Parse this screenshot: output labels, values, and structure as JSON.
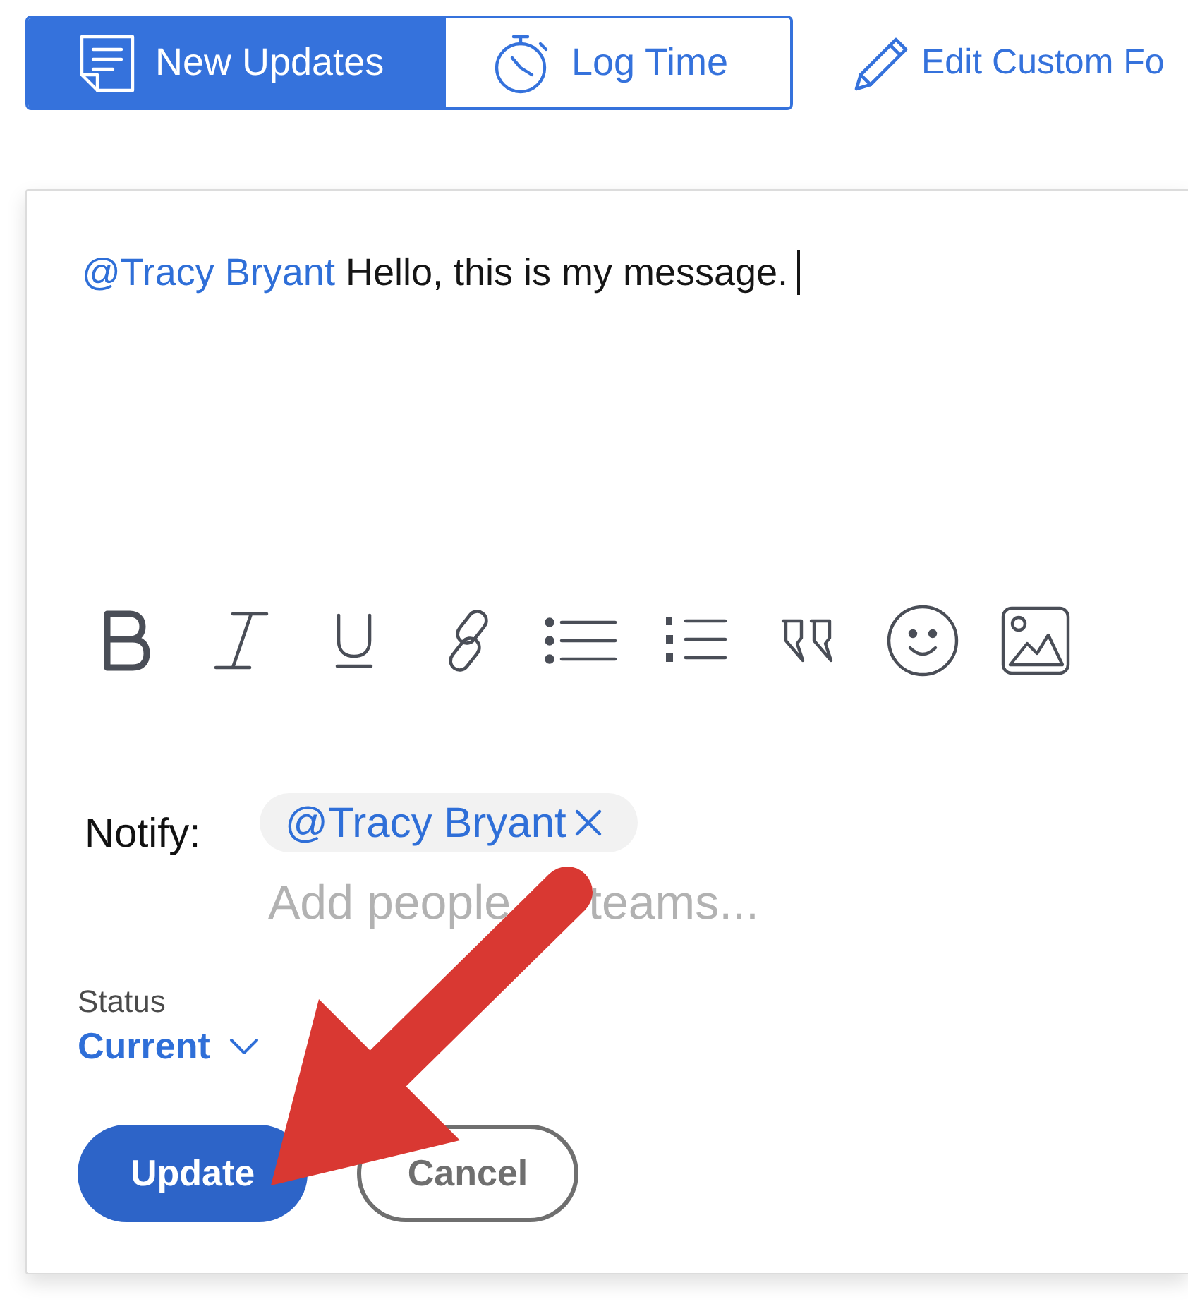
{
  "tabs": [
    {
      "label": "New Updates",
      "selected": true
    },
    {
      "label": "Log Time",
      "selected": false
    }
  ],
  "edit_link": {
    "label": "Edit Custom Fo"
  },
  "editor": {
    "mention": "@Tracy Bryant",
    "text": "Hello, this is my message.",
    "cursor": true
  },
  "notify": {
    "label": "Notify:",
    "chips": [
      {
        "label": "@Tracy Bryant"
      }
    ],
    "placeholder": [
      "Add people",
      "teams..."
    ]
  },
  "status": {
    "label": "Status",
    "value": "Current"
  },
  "buttons": [
    {
      "label": "Update",
      "kind": "primary"
    },
    {
      "label": "Cancel",
      "kind": "secondary"
    }
  ]
}
